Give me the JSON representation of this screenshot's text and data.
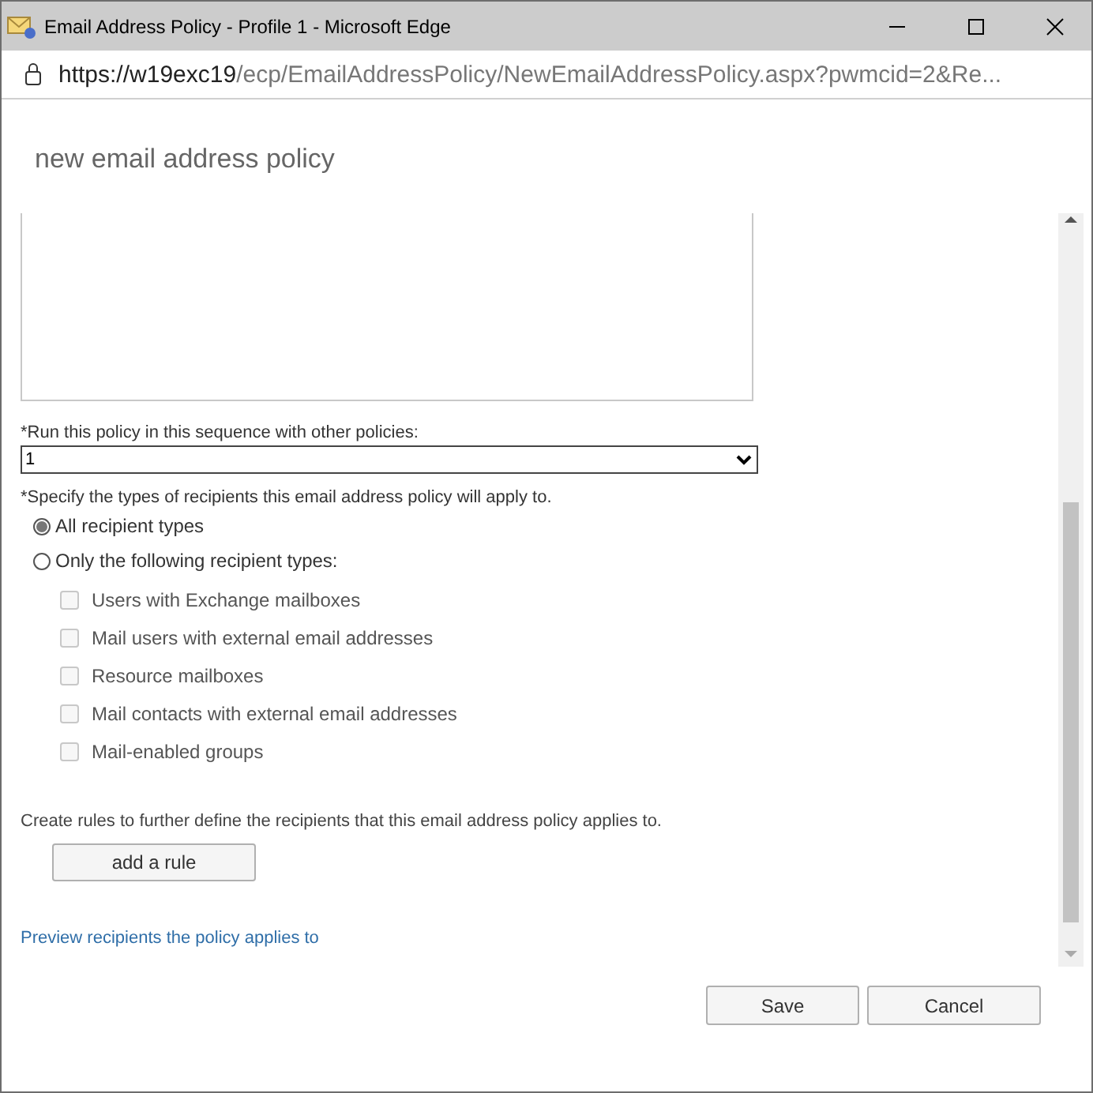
{
  "window": {
    "title": "Email Address Policy - Profile 1 - Microsoft Edge"
  },
  "address_bar": {
    "host": "https://w19exc19",
    "path": "/ecp/EmailAddressPolicy/NewEmailAddressPolicy.aspx?pwmcid=2&Re..."
  },
  "page": {
    "heading": "new email address policy"
  },
  "sequence": {
    "label": "*Run this policy in this sequence with other policies:",
    "value": "1"
  },
  "recipient_types": {
    "label": "*Specify the types of recipients this email address policy will apply to.",
    "options": [
      {
        "label": "All recipient types",
        "selected": true
      },
      {
        "label": "Only the following recipient types:",
        "selected": false
      }
    ],
    "types": [
      {
        "label": "Users with Exchange mailboxes",
        "checked": false,
        "disabled": true
      },
      {
        "label": "Mail users with external email addresses",
        "checked": false,
        "disabled": true
      },
      {
        "label": "Resource mailboxes",
        "checked": false,
        "disabled": true
      },
      {
        "label": "Mail contacts with external email addresses",
        "checked": false,
        "disabled": true
      },
      {
        "label": "Mail-enabled groups",
        "checked": false,
        "disabled": true
      }
    ]
  },
  "rules": {
    "text": "Create rules to further define the recipients that this email address policy applies to.",
    "button": "add a rule"
  },
  "preview_link": "Preview recipients the policy applies to",
  "buttons": [
    "Save",
    "Cancel"
  ]
}
